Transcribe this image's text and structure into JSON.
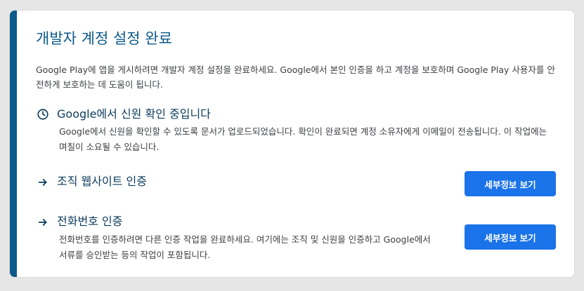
{
  "card": {
    "title": "개발자 계정 설정 완료",
    "intro": "Google Play에 앱을 게시하려면 개발자 계정 설정을 완료하세요. Google에서 본인 인증을 하고 계정을 보호하며 Google Play 사용자를 안전하게 보호하는 데 도움이 됩니다."
  },
  "sections": [
    {
      "icon": "clock-icon",
      "heading": "Google에서 신원 확인 중입니다",
      "description": "Google에서 신원을 확인할 수 있도록 문서가 업로드되었습니다. 확인이 완료되면 계정 소유자에게 이메일이 전송됩니다. 이 작업에는 며칠이 소요될 수 있습니다."
    },
    {
      "icon": "arrow-right-icon",
      "heading": "조직 웹사이트 인증",
      "button_label": "세부정보 보기"
    },
    {
      "icon": "arrow-right-icon",
      "heading": "전화번호 인증",
      "description": "전화번호를 인증하려면 다른 인증 작업을 완료하세요. 여기에는 조직 및 신원을 인증하고 Google에서 서류를 승인받는 등의 작업이 포함됩니다.",
      "button_label": "세부정보 보기"
    }
  ],
  "colors": {
    "accent": "#0b5a8a",
    "button": "#1a73e8",
    "heading": "#0b3a5a",
    "body_text": "#3c4043"
  }
}
